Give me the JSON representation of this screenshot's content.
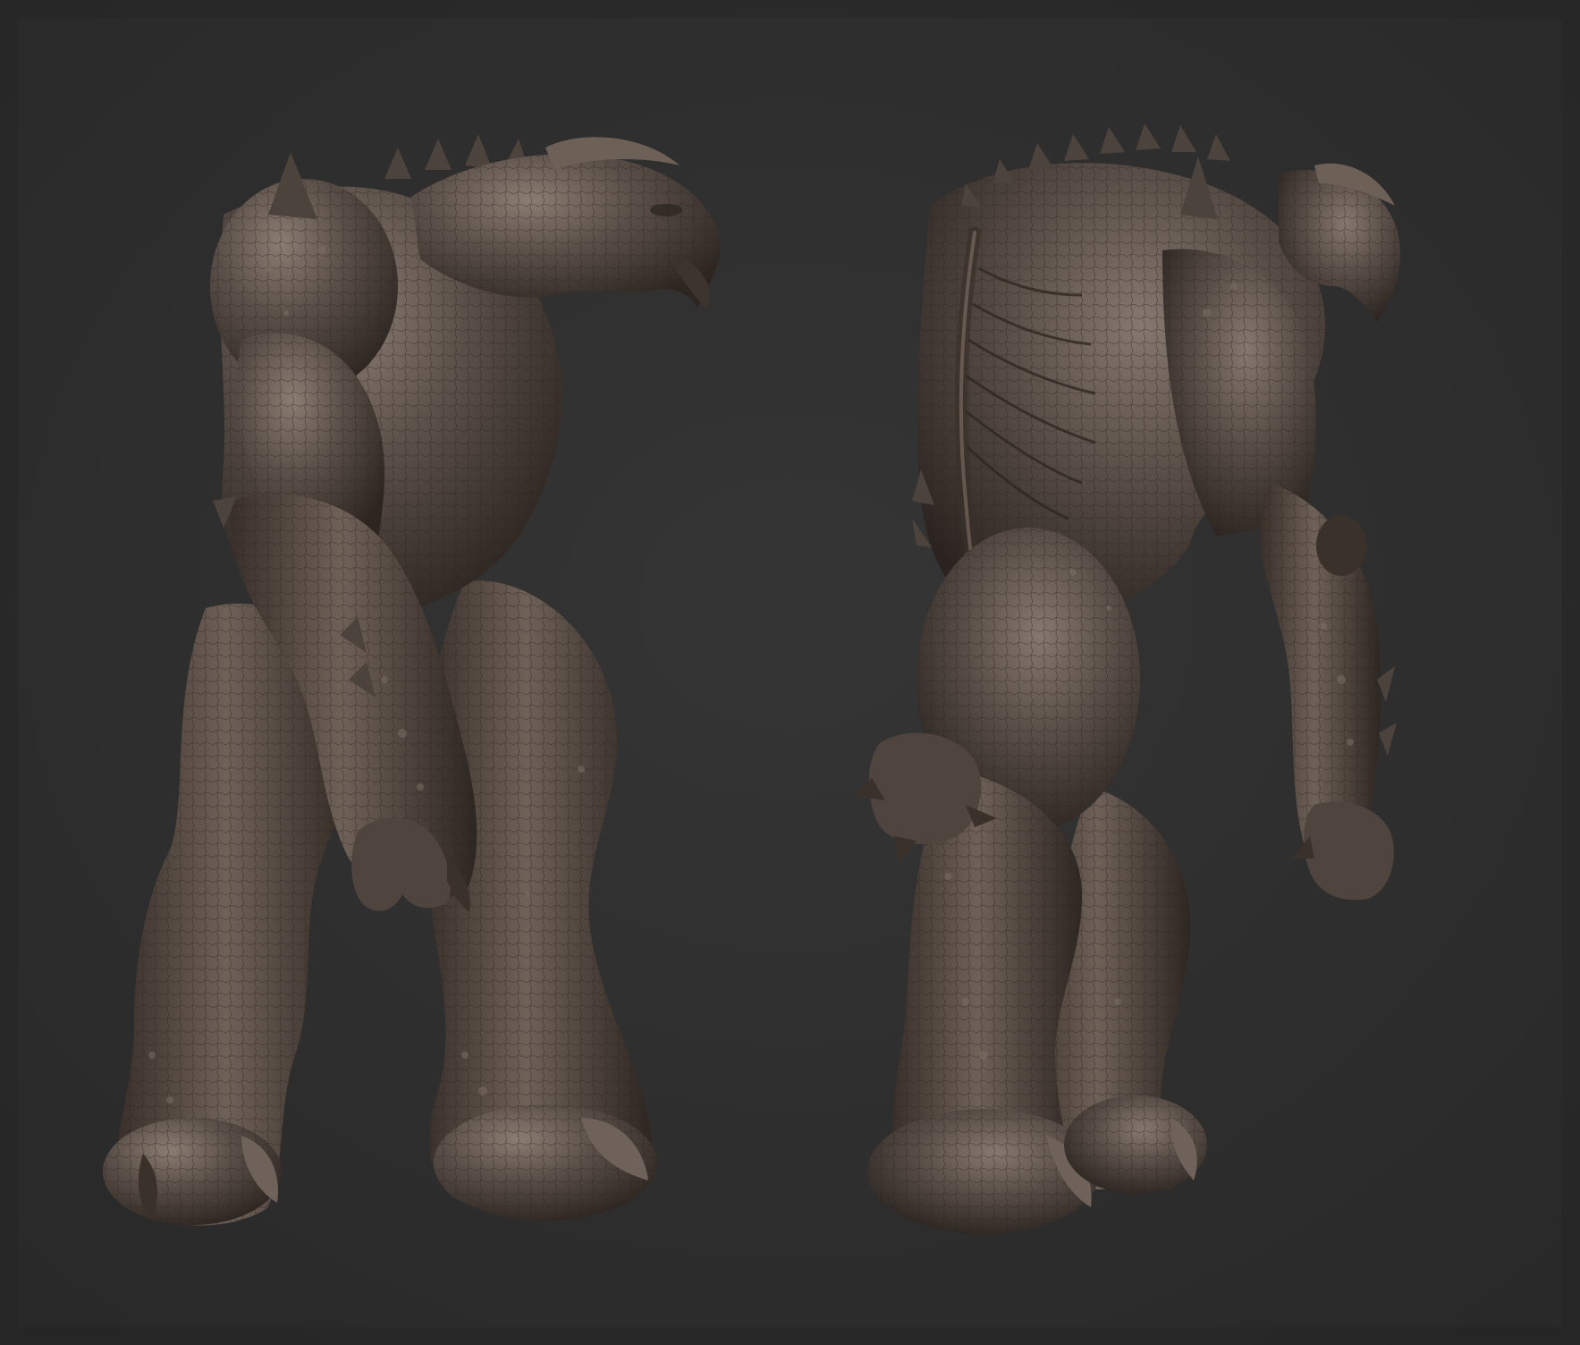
{
  "scene": {
    "background": "#2e2e2e",
    "clay_color": "#5b5049",
    "clay_highlight": "#8a7c72",
    "clay_shadow": "#2d2520",
    "figures": [
      {
        "name": "creature-front-side-view",
        "facing": "right"
      },
      {
        "name": "creature-back-side-view",
        "facing": "right"
      }
    ]
  }
}
